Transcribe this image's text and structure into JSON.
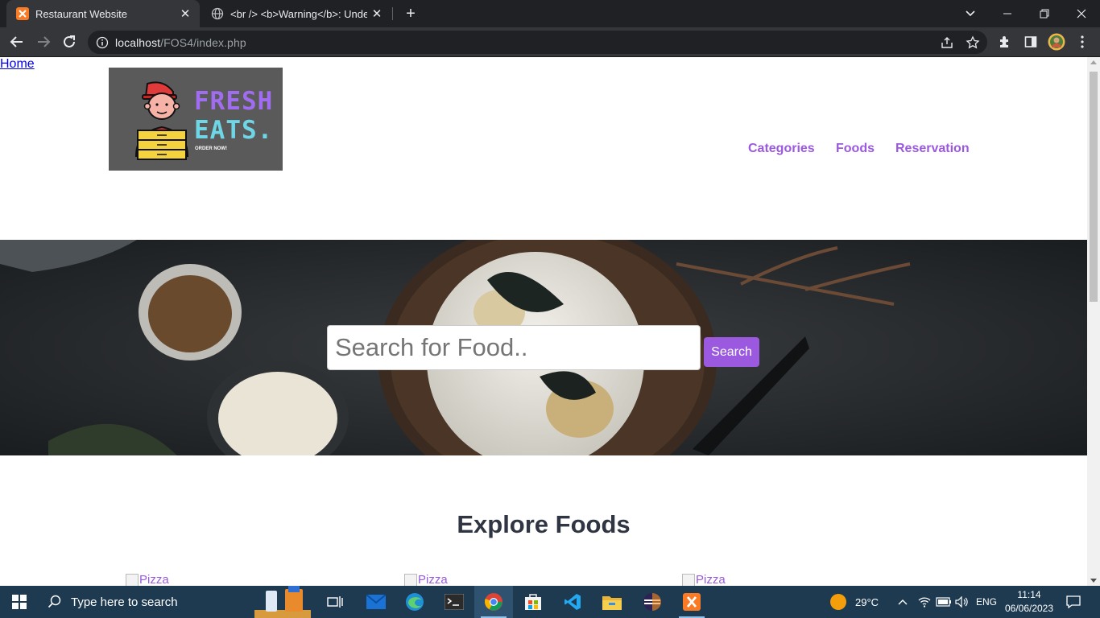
{
  "browser": {
    "tabs": [
      {
        "title": "Restaurant Website",
        "active": true,
        "favicon": "xampp-icon"
      },
      {
        "title": "<br /> <b>Warning</b>: Undef",
        "active": false,
        "favicon": "globe-icon"
      }
    ],
    "url_host": "localhost",
    "url_path": "/FOS4/index.php"
  },
  "site": {
    "logo": {
      "line1": "FRESH",
      "line2": "EATS.",
      "tagline": "ORDER NOW!"
    },
    "nav": [
      "Home",
      "Categories",
      "Foods",
      "Reservation"
    ],
    "search": {
      "placeholder": "Search for Food..",
      "button": "Search"
    },
    "section_title": "Explore Foods",
    "food_alts": [
      "Pizza",
      "Pizza",
      "Pizza"
    ]
  },
  "taskbar": {
    "search_placeholder": "Type here to search",
    "weather": "29°C",
    "language": "ENG",
    "time": "11:14",
    "date": "06/06/2023"
  },
  "colors": {
    "accent": "#9b59e0",
    "taskbar": "#1e3a50"
  }
}
